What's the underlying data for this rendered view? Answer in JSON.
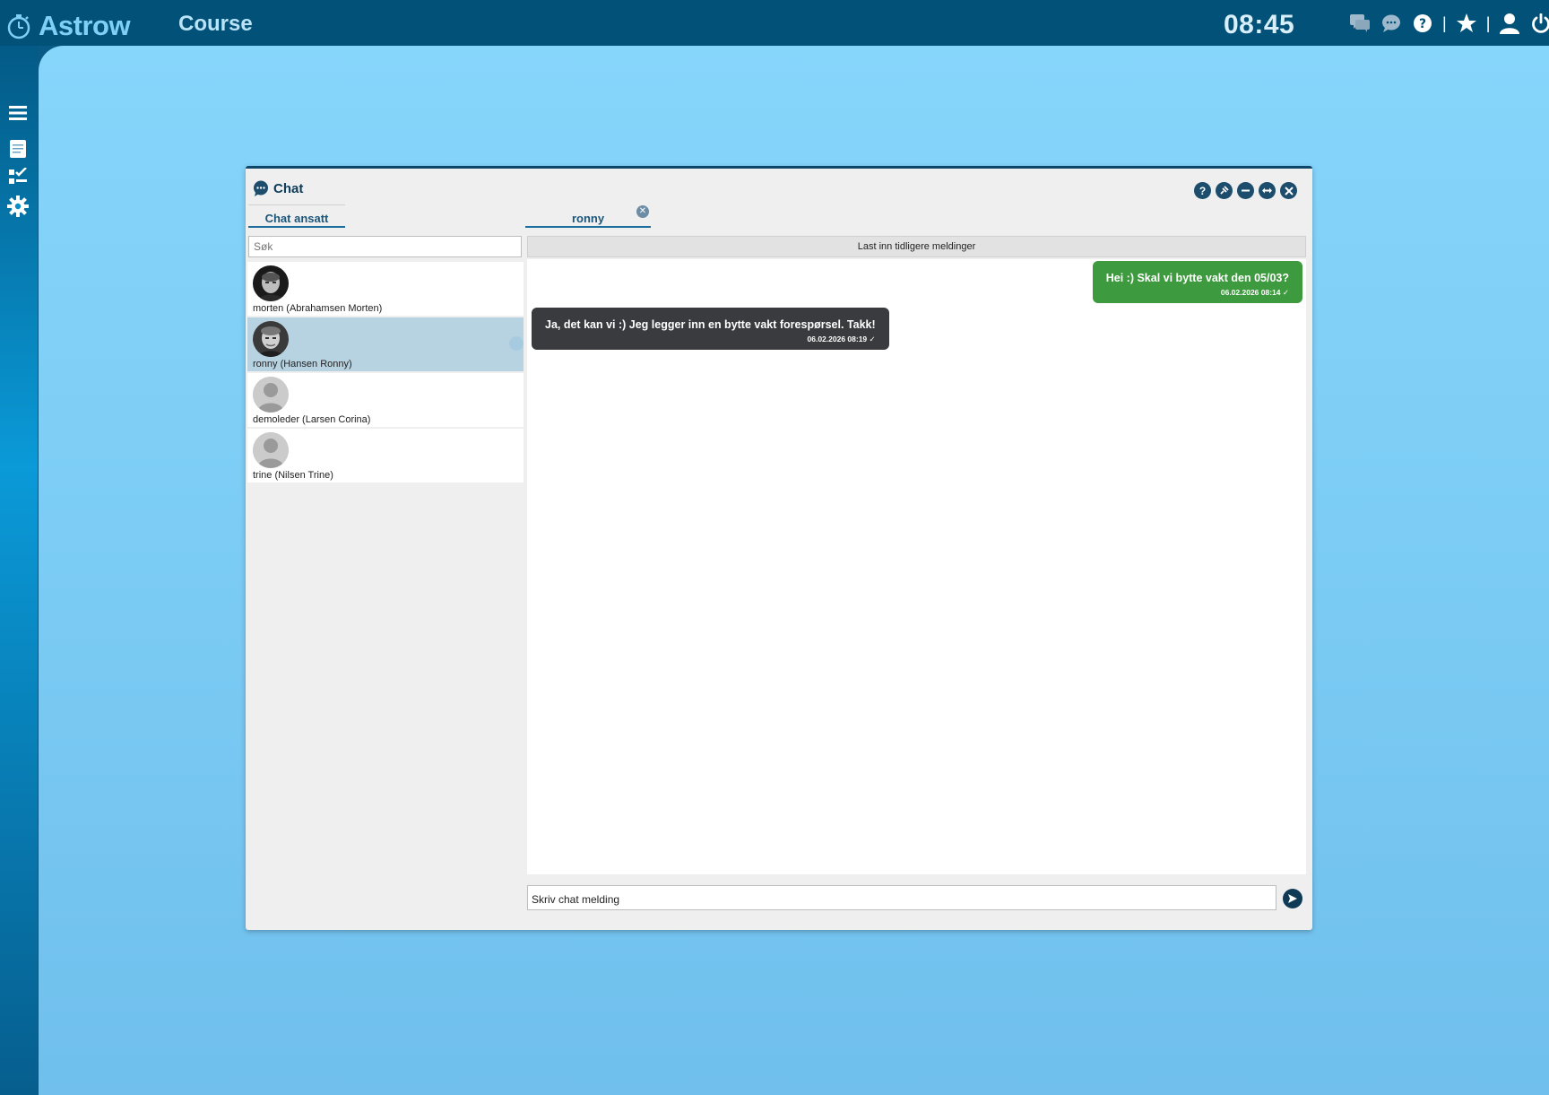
{
  "app": {
    "name": "Astrow",
    "module": "Course",
    "clock": "08:45"
  },
  "topbar_icons": [
    "chat-bubbles-icon",
    "chat-bubble-icon",
    "help-icon",
    "star-icon",
    "user-icon",
    "power-icon"
  ],
  "sidebar_icons": [
    "menu-icon",
    "document-icon",
    "checklist-icon",
    "gear-icon"
  ],
  "chat_window": {
    "title": "Chat",
    "controls": [
      "help-icon",
      "pin-icon",
      "minimize-icon",
      "resize-icon",
      "close-icon"
    ],
    "left_tab": "Chat ansatt",
    "search_placeholder": "Søk",
    "contacts": [
      {
        "name": "morten (Abrahamsen Morten)",
        "avatar": "photo",
        "selected": false
      },
      {
        "name": "ronny (Hansen Ronny)",
        "avatar": "photo",
        "selected": true
      },
      {
        "name": "demoleder (Larsen Corina)",
        "avatar": "default",
        "selected": false
      },
      {
        "name": "trine (Nilsen Trine)",
        "avatar": "default",
        "selected": false
      }
    ],
    "conversation_tab": "ronny",
    "load_earlier": "Last inn tidligere meldinger",
    "messages": [
      {
        "direction": "out",
        "text": "Hei :) Skal vi bytte vakt den 05/03?",
        "meta": "06.02.2026 08:14 ✓"
      },
      {
        "direction": "in",
        "text": "Ja, det kan vi :) Jeg legger inn en bytte vakt forespørsel. Takk!",
        "meta": "06.02.2026 08:19 ✓"
      }
    ],
    "input_placeholder": "Skriv chat melding"
  },
  "colors": {
    "topbar": "#025178",
    "background": "#86d5fb",
    "outgoing_bubble": "#3e9a3e",
    "incoming_bubble": "#3a3b3e",
    "accent": "#1a6c9a"
  }
}
